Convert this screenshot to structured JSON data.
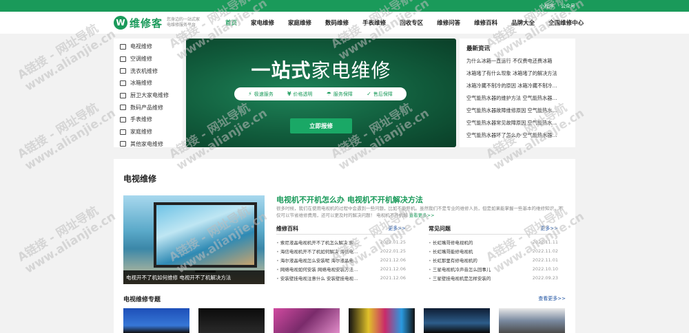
{
  "topbar": {
    "links": [
      "小程序",
      "公众号"
    ]
  },
  "logo": {
    "mark": "W",
    "name": "维修客",
    "slogan": "您身边的一站式家电维修服务平台"
  },
  "nav": {
    "items": [
      "首页",
      "家电维修",
      "家庭维修",
      "数码维修",
      "手表维修",
      "回收专区",
      "维修问答",
      "维修百科",
      "品牌大全",
      "全国维修中心"
    ]
  },
  "categories": [
    "电视维修",
    "空调维修",
    "洗衣机维修",
    "冰箱维修",
    "厨卫大家电维修",
    "数码产品维修",
    "手表维修",
    "家庭维修",
    "其他家电维修"
  ],
  "banner": {
    "title_bold": "一站式",
    "title_rest": "家电维修",
    "pills": [
      {
        "icon": "lightning-icon",
        "glyph": "⚡",
        "label": "极速服务"
      },
      {
        "icon": "yen-icon",
        "glyph": "¥",
        "label": "价格透明"
      },
      {
        "icon": "umbrella-icon",
        "glyph": "☂",
        "label": "服务保障"
      },
      {
        "icon": "shield-icon",
        "glyph": "✓",
        "label": "售后保障"
      }
    ],
    "button": "立即报修"
  },
  "news": {
    "heading": "最新资讯",
    "items": [
      "为什么冰箱一直运行 不仅费电还费冰箱",
      "冰箱堵了有什么现象 冰箱堵了的解决方法",
      "冰箱冷藏不制冷的原因 冰箱冷藏不制冷…",
      "空气能热水器的维护方法 空气能热水器…",
      "空气能热水器故障维修原因 空气能热水…",
      "空气能热水器常见故障原因 空气能热水…",
      "空气能热水器坏了怎么办 空气能热水器…"
    ]
  },
  "tv_section": {
    "title": "电视维修",
    "feature_caption": "电视开不了机如何维修 电视开不了机解决方法",
    "article_title": "电视机不开机怎么办 电视机不开机解决方法",
    "article_desc": "很多时候，我们在使用电视机的过程中会遇到一些问题，比如不能开机。虽然我们不是专业的维修人员，但是如果能掌握一些基本的维修知识，不仅可以节省维修费用，还可以更及时的解决问题！ 电视机不开机解",
    "article_more": "查看更多>>",
    "baike": {
      "title": "维修百科",
      "more": "更多>>",
      "rows": [
        {
          "t": "索尼液晶电视机开不了机怎么解决 索…",
          "d": "2022.01.25"
        },
        {
          "t": "海信电视机开不了机如何解决 海信电…",
          "d": "2022.01.25"
        },
        {
          "t": "海尔液晶电视怎么安装呢 海尔液晶电…",
          "d": "2021.12.06"
        },
        {
          "t": "网络电视如何安装 网络电视安装方法…",
          "d": "2021.12.06"
        },
        {
          "t": "安装壁挂电视注意什么 安装壁挂电视…",
          "d": "2021.12.06"
        }
      ]
    },
    "faq": {
      "title": "常见问题",
      "more": "更多>>",
      "rows": [
        {
          "t": "长虹嘴哥修电视机的",
          "d": "2022.11.11"
        },
        {
          "t": "长虹嘴哥能修电视机",
          "d": "2022.11.02"
        },
        {
          "t": "长虹那里有修电视机的",
          "d": "2022.11.01"
        },
        {
          "t": "三星电视机冷声音怎么回事儿",
          "d": "2022.10.10"
        },
        {
          "t": "三星壁挂电视机是怎样安装的",
          "d": "2022.09.23"
        }
      ]
    },
    "topic_title": "电视维修专题",
    "topic_more": "查看更多>>"
  },
  "watermark": {
    "line1": "A链接 - 网址导航",
    "line2": "www.alianjie.cn"
  }
}
